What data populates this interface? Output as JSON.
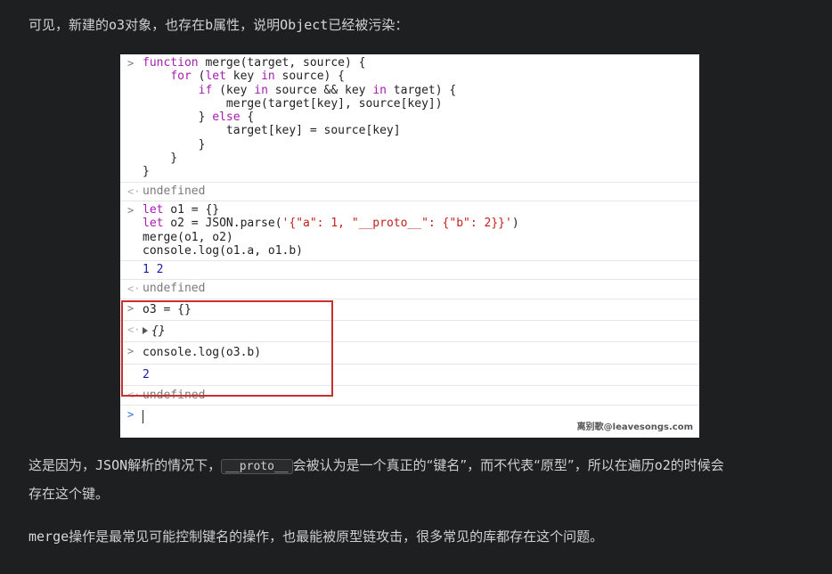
{
  "paragraph1": {
    "before": "可见，新建的",
    "code1": "o3",
    "middle1": "对象，也存在",
    "code2": "b",
    "middle2": "属性，说明",
    "code3": "Object",
    "after": "已经被污染："
  },
  "console": {
    "entry1": {
      "lines": [
        "function merge(target, source) {",
        "    for (let key in source) {",
        "        if (key in source && key in target) {",
        "            merge(target[key], source[key])",
        "        } else {",
        "            target[key] = source[key]",
        "        }",
        "    }",
        "}"
      ],
      "result": "undefined"
    },
    "entry2": {
      "line1_kw": "let",
      "line1_rest": " o1 = {}",
      "line2_kw": "let",
      "line2_mid": " o2 = JSON.parse(",
      "line2_str": "'{\"a\": 1, \"__proto__\": {\"b\": 2}}'",
      "line2_end": ")",
      "line3": "merge(o1, o2)",
      "line4": "console.log(o1.a, o1.b)",
      "log_output": "1 2",
      "result": "undefined"
    },
    "entry3": {
      "input": "o3 = {}",
      "output": "{}"
    },
    "entry4": {
      "input": "console.log(o3.b)",
      "log_output": "2",
      "result": "undefined"
    },
    "prompt_symbol": ">",
    "return_symbol": "<·",
    "watermark": "离别歌@leavesongs.com"
  },
  "paragraph2": {
    "before": "这是因为，",
    "code1": "JSON",
    "middle1": "解析的情况下，",
    "inline_code": "__proto__",
    "after_line1": "会被认为是一个真正的“键名”，而不代表“原型”，所以在遍历",
    "code2": "o2",
    "after_line1b": "的时候会",
    "line2": "存在这个键。"
  },
  "paragraph3": {
    "code": "merge",
    "text": "操作是最常见可能控制键名的操作，也最能被原型链攻击，很多常见的库都存在这个问题。"
  },
  "colors": {
    "page_bg": "#1e1f21",
    "highlight_border": "#c9302c",
    "keyword": "#a51cb0",
    "string": "#c4201a",
    "number": "#1a1aa6"
  }
}
